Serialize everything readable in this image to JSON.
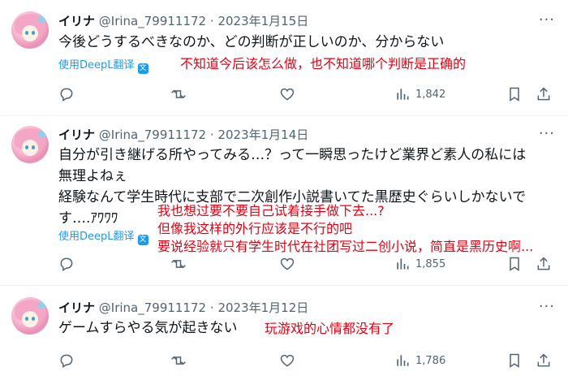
{
  "tweets": [
    {
      "name": "イリナ",
      "handle": "@Irina_79911172",
      "separator": "·",
      "date": "2023年1月15日",
      "text_lines": [
        "今後どうするべきなのか、どの判断が正しいのか、分からない"
      ],
      "translate_label": "使用DeepL翻译",
      "translation_lines": [
        "不知道今后该怎么做，也不知道哪个判断是正确的"
      ],
      "views": "1,842"
    },
    {
      "name": "イリナ",
      "handle": "@Irina_79911172",
      "separator": "·",
      "date": "2023年1月14日",
      "text_lines": [
        "自分が引き継げる所やってみる…？って一瞬思ったけど業界ど素人の私には",
        "無理よねぇ",
        "経験なんて学生時代に支部で二次創作小説書いてた黒歴史ぐらいしかないで",
        "す….ｱﾜﾜﾜ"
      ],
      "translate_label": "使用DeepL翻译",
      "translation_lines": [
        "我也想过要不要自己试着接手做下去...?",
        "但像我这样的外行应该是不行的吧",
        "要说经验就只有学生时代在社团写过二创小说，简直是黑历史啊..."
      ],
      "views": "1,855"
    },
    {
      "name": "イリナ",
      "handle": "@Irina_79911172",
      "separator": "·",
      "date": "2023年1月12日",
      "text_lines": [
        "ゲームすらやる気が起きない"
      ],
      "translation_lines": [
        "玩游戏的心情都没有了"
      ],
      "views": "1,786"
    }
  ],
  "more_glyph": "···",
  "colors": {
    "text": "#0f1419",
    "muted": "#536471",
    "link": "#1d9bf0",
    "annotation": "#e60012",
    "divider": "#eff3f4"
  },
  "icons": [
    "reply-icon",
    "retweet-icon",
    "like-icon",
    "views-icon",
    "bookmark-icon",
    "share-icon"
  ]
}
